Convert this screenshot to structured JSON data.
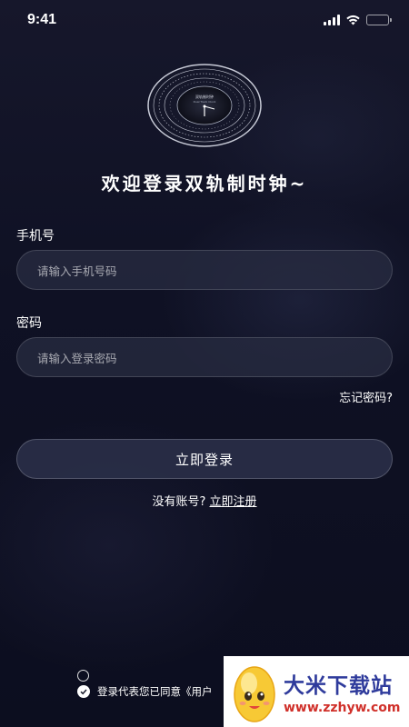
{
  "status": {
    "time": "9:41"
  },
  "header": {
    "welcome": "欢迎登录双轨制时钟~",
    "logo_text_1": "双轨制时钟",
    "logo_text_2": "Dual Track Clock"
  },
  "form": {
    "phone_label": "手机号",
    "phone_placeholder": "请输入手机号码",
    "password_label": "密码",
    "password_placeholder": "请输入登录密码",
    "forgot_label": "忘记密码?",
    "login_label": "立即登录",
    "no_account_text": "没有账号?",
    "register_label": "立即注册"
  },
  "agreement": {
    "text": "登录代表您已同意《用户"
  },
  "watermark": {
    "title": "大米下载站",
    "url": "www.zzhyw.com"
  },
  "colors": {
    "background": "#0d0f1f",
    "input_bg": "#282c42",
    "watermark_blue": "#2f3b9c",
    "watermark_red": "#d0302a"
  }
}
